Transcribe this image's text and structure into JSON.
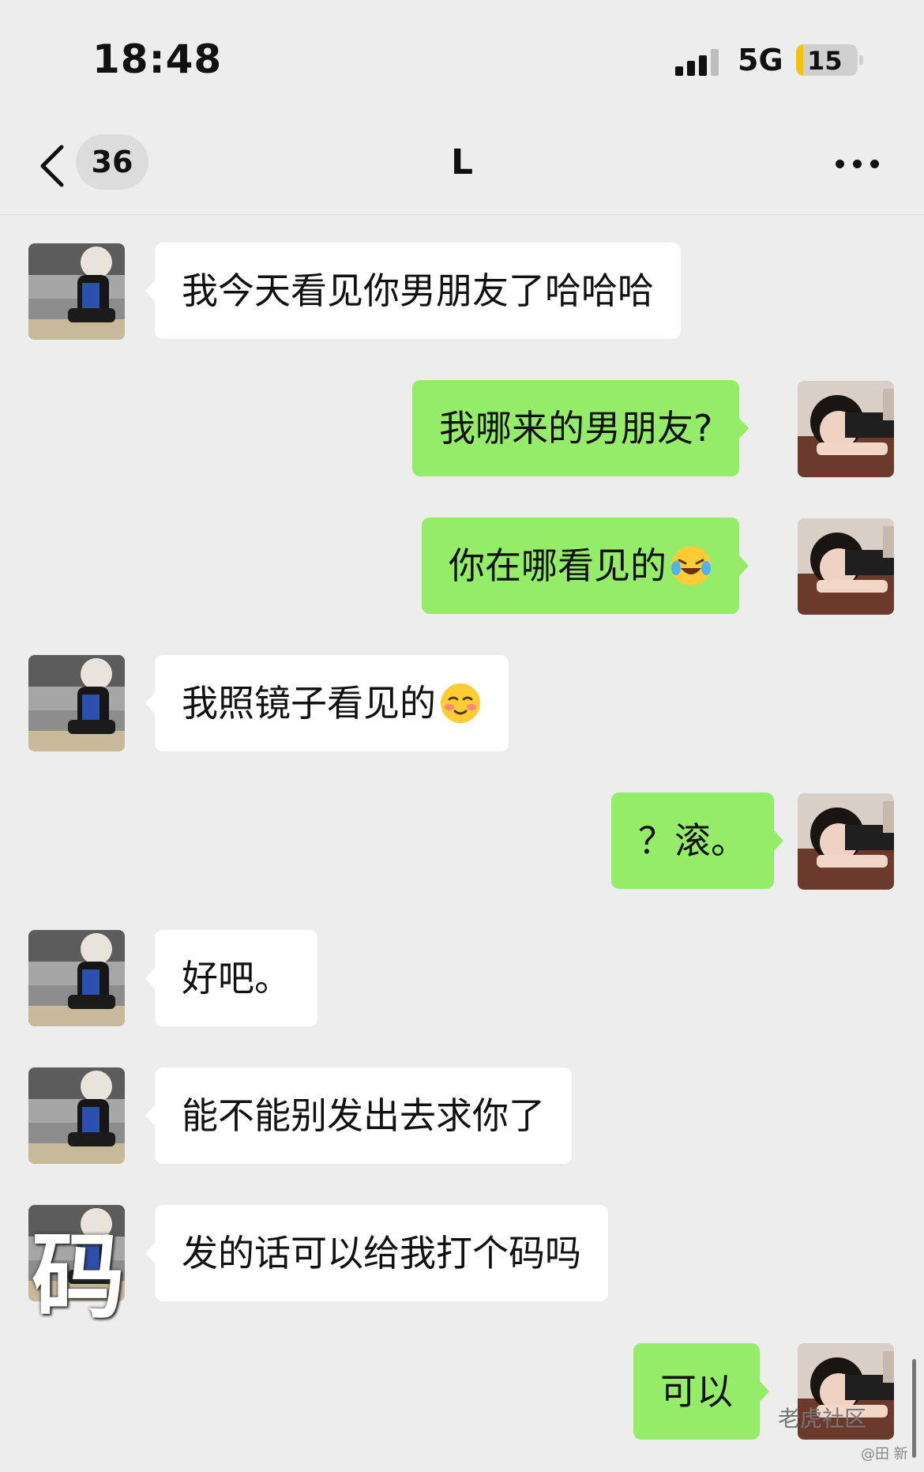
{
  "status_bar": {
    "time": "18:48",
    "network": "5G",
    "battery": "15",
    "battery_color": "#f4c20d"
  },
  "nav": {
    "unread_count": "36",
    "title": "L",
    "back_icon": "chevron-left-icon",
    "more_icon": "ellipsis-icon"
  },
  "messages": [
    {
      "side": "left",
      "text": "我今天看见你男朋友了哈哈哈"
    },
    {
      "side": "right",
      "text": "我哪来的男朋友?"
    },
    {
      "side": "right",
      "text": "你在哪看见的",
      "emoji": "laughing-crying-emoji"
    },
    {
      "side": "left",
      "text": "我照镜子看见的",
      "emoji": "blushing-smile-emoji"
    },
    {
      "side": "right",
      "text": "？滚。"
    },
    {
      "side": "left",
      "text": "好吧。"
    },
    {
      "side": "left",
      "text": "能不能别发出去求你了"
    },
    {
      "side": "left",
      "text": "发的话可以给我打个码吗"
    },
    {
      "side": "right",
      "text": "可以"
    }
  ],
  "overlay_char": "码",
  "watermark": {
    "main": "老虎社区",
    "sub": "@田 新"
  },
  "colors": {
    "background": "#ededed",
    "outgoing_bubble": "#95ec69",
    "incoming_bubble": "#ffffff"
  }
}
